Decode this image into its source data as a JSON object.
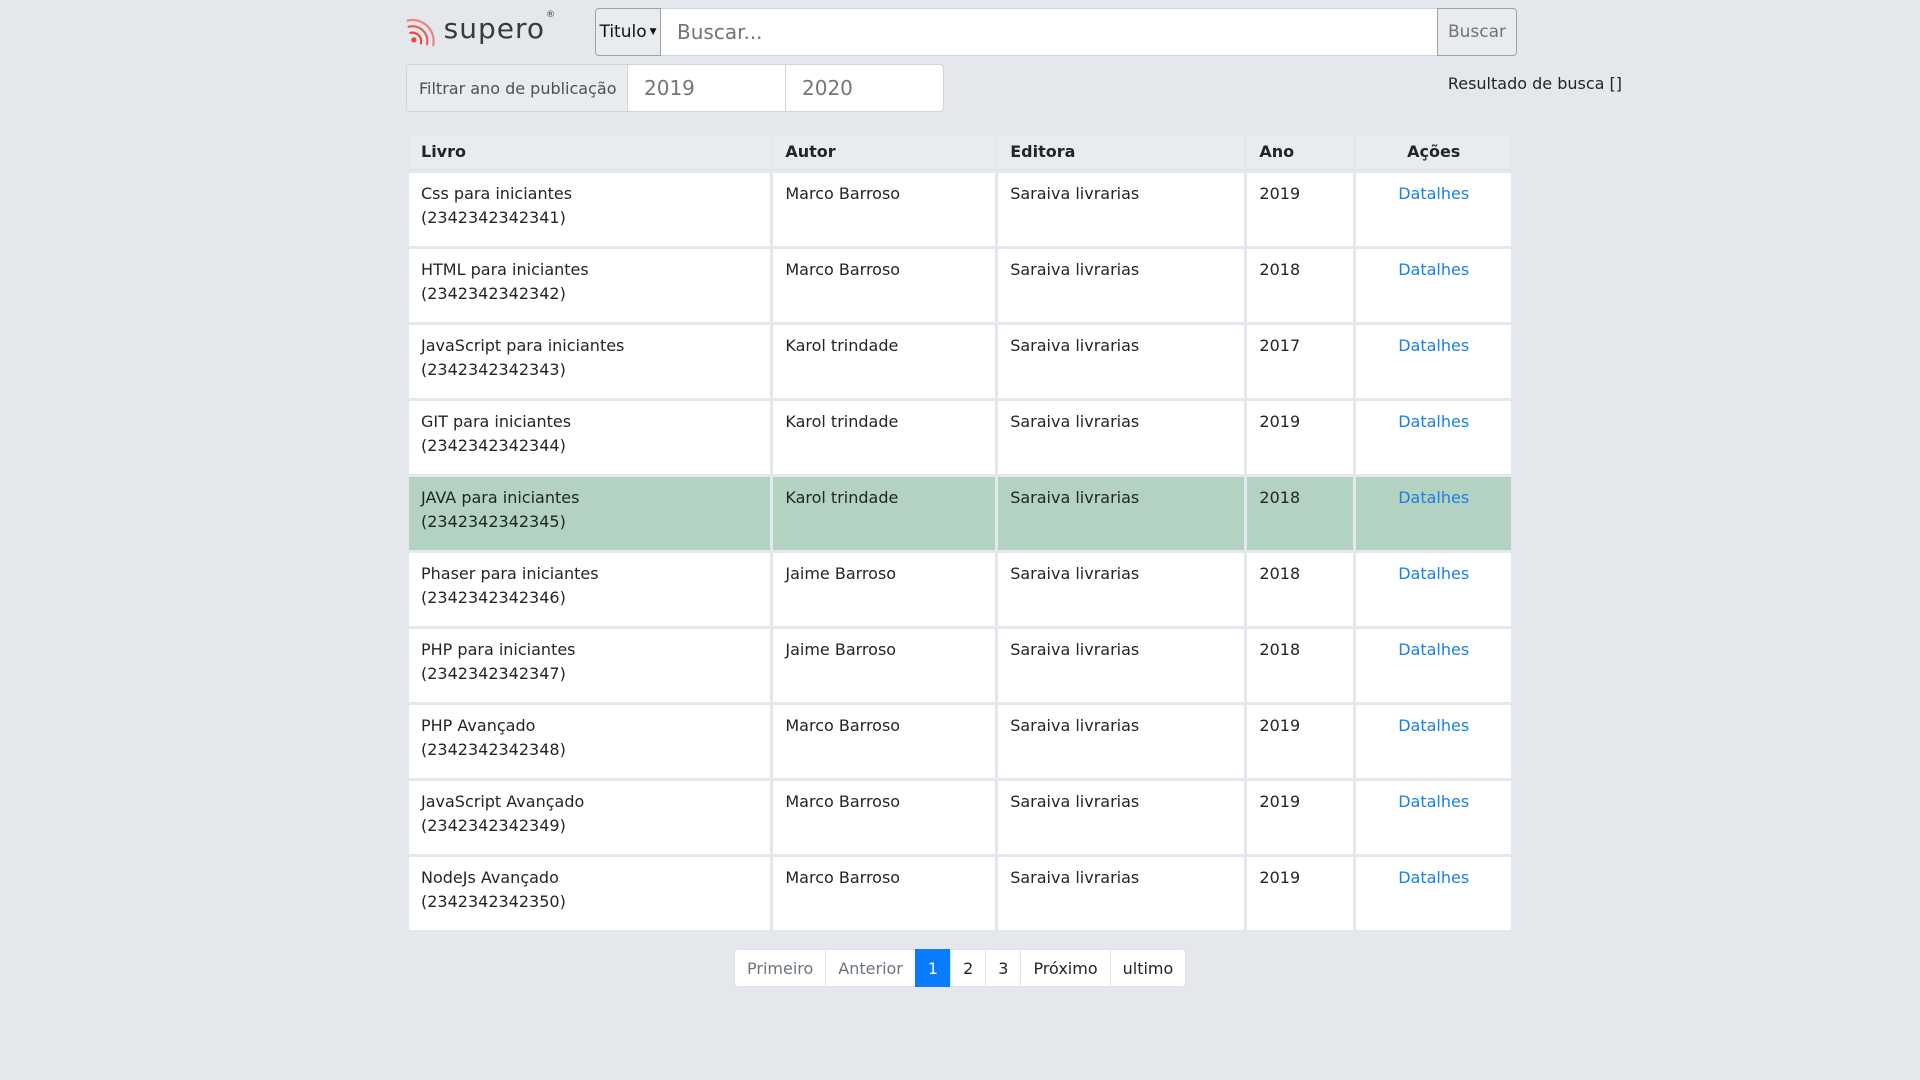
{
  "brand": {
    "name": "supero",
    "mark": "®"
  },
  "search": {
    "type_label": "Titulo",
    "placeholder": "Buscar...",
    "button_label": "Buscar"
  },
  "filter": {
    "label": "Filtrar ano de publicação",
    "from_placeholder": "2019",
    "to_placeholder": "2020"
  },
  "result_text": "Resultado de busca []",
  "table": {
    "headers": [
      "Livro",
      "Autor",
      "Editora",
      "Ano",
      "Ações"
    ],
    "rows": [
      {
        "title": "Css para iniciantes",
        "isbn": "(2342342342341)",
        "author": "Marco Barroso",
        "publisher": "Saraiva livrarias",
        "year": "2019",
        "action": "Datalhes"
      },
      {
        "title": "HTML para iniciantes",
        "isbn": "(2342342342342)",
        "author": "Marco Barroso",
        "publisher": "Saraiva livrarias",
        "year": "2018",
        "action": "Datalhes"
      },
      {
        "title": "JavaScript para iniciantes",
        "isbn": "(2342342342343)",
        "author": "Karol trindade",
        "publisher": "Saraiva livrarias",
        "year": "2017",
        "action": "Datalhes"
      },
      {
        "title": "GIT para iniciantes",
        "isbn": "(2342342342344)",
        "author": "Karol trindade",
        "publisher": "Saraiva livrarias",
        "year": "2019",
        "action": "Datalhes"
      },
      {
        "title": "JAVA para iniciantes",
        "isbn": "(2342342342345)",
        "author": "Karol trindade",
        "publisher": "Saraiva livrarias",
        "year": "2018",
        "action": "Datalhes"
      },
      {
        "title": "Phaser para iniciantes",
        "isbn": "(2342342342346)",
        "author": "Jaime Barroso",
        "publisher": "Saraiva livrarias",
        "year": "2018",
        "action": "Datalhes"
      },
      {
        "title": "PHP para iniciantes",
        "isbn": "(2342342342347)",
        "author": "Jaime Barroso",
        "publisher": "Saraiva livrarias",
        "year": "2018",
        "action": "Datalhes"
      },
      {
        "title": "PHP Avançado",
        "isbn": "(2342342342348)",
        "author": "Marco Barroso",
        "publisher": "Saraiva livrarias",
        "year": "2019",
        "action": "Datalhes"
      },
      {
        "title": "JavaScript Avançado",
        "isbn": "(2342342342349)",
        "author": "Marco Barroso",
        "publisher": "Saraiva livrarias",
        "year": "2019",
        "action": "Datalhes"
      },
      {
        "title": "NodeJs Avançado",
        "isbn": "(2342342342350)",
        "author": "Marco Barroso",
        "publisher": "Saraiva livrarias",
        "year": "2019",
        "action": "Datalhes"
      }
    ],
    "selected_row": 4
  },
  "pagination": {
    "first": "Primeiro",
    "prev": "Anterior",
    "pages": [
      "1",
      "2",
      "3"
    ],
    "active_page": "1",
    "next": "Próximo",
    "last": "ultimo"
  },
  "colors": {
    "background": "#e4e7eb",
    "link": "#1b7fe3",
    "selected_row": "#b4d2c2",
    "active_page": "#0a7bff",
    "logo_accent": "#e8473b"
  },
  "icons": {
    "logo": "supero-signal-icon",
    "dropdown": "caret-down-icon"
  }
}
